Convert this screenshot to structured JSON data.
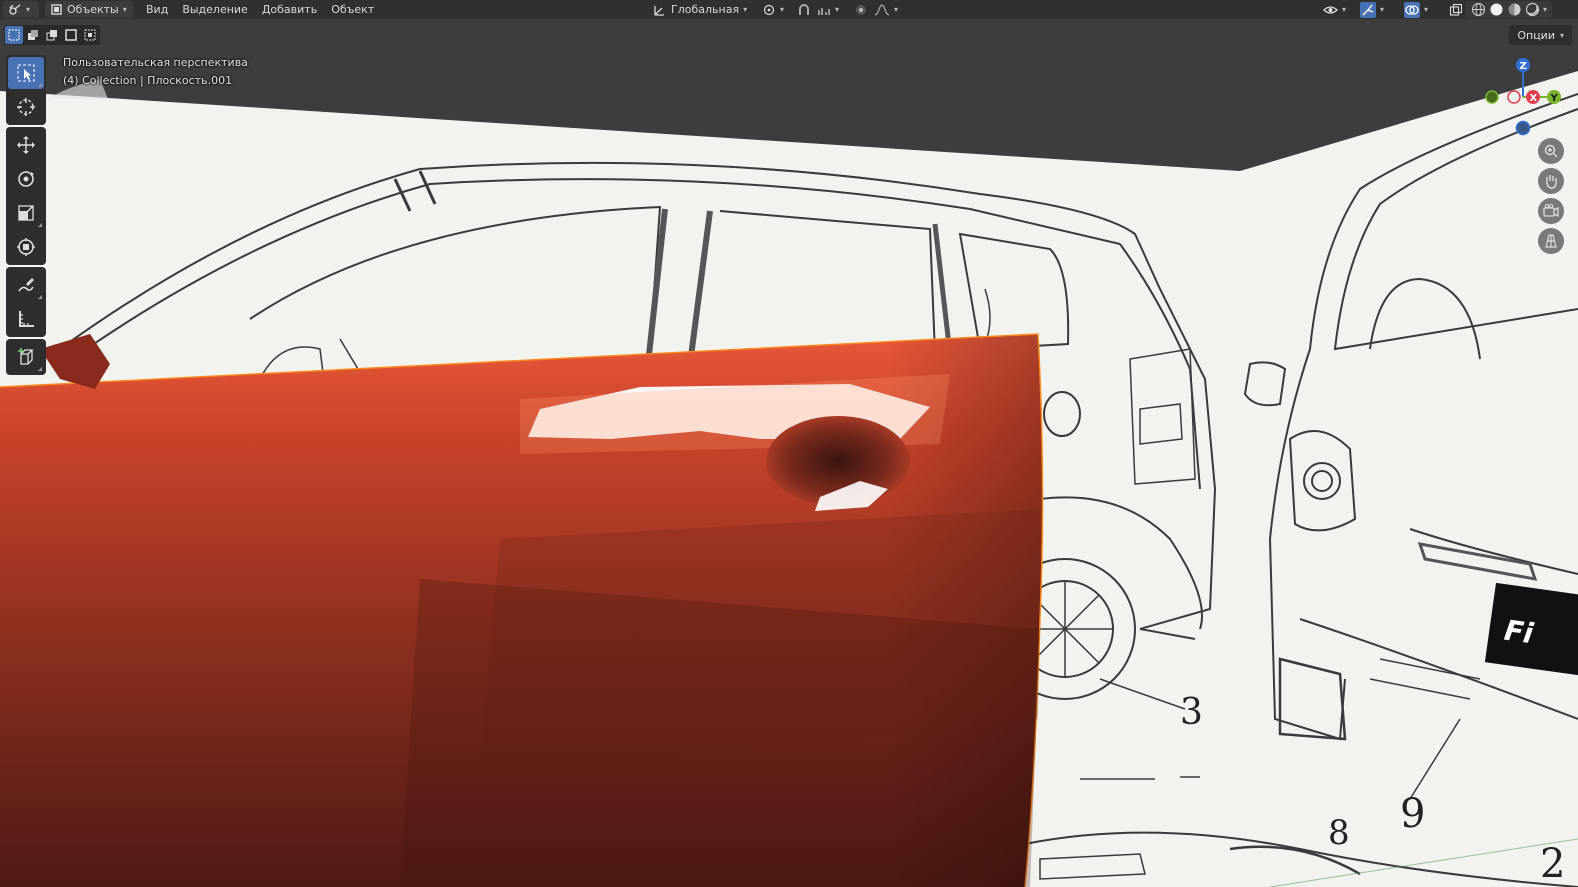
{
  "header": {
    "mode_label": "Объекты",
    "menu": [
      "Вид",
      "Выделение",
      "Добавить",
      "Объект"
    ],
    "transform_orientation": "Глобальная",
    "icons": [
      "editor-type-icon",
      "object-mode-icon",
      "orientation-icon",
      "pivot-icon",
      "snap-icon",
      "snap-target-icon",
      "proportional-edit-icon",
      "falloff-icon",
      "visibility-icon",
      "gizmo-icon",
      "overlay-icon",
      "xray-icon",
      "wireframe-shading-icon",
      "solid-shading-icon",
      "material-shading-icon",
      "rendered-shading-icon"
    ]
  },
  "viewport": {
    "perspective_label": "Пользовательская перспектива",
    "collection_label": "(4) Collection | Плоскость.001",
    "options_label": "Опции",
    "gizmo_axes": {
      "z": "Z",
      "x": "X",
      "y": "Y"
    },
    "reference_numbers": [
      "3",
      "9",
      "8",
      "2"
    ],
    "door_color": "#c9432a",
    "background_color": "#f2f2ef",
    "accent_color": "#4772b3"
  },
  "toolbar": {
    "tools": [
      "select-box",
      "cursor",
      "move",
      "rotate",
      "scale",
      "transform",
      "annotate",
      "measure",
      "add-cube"
    ]
  }
}
